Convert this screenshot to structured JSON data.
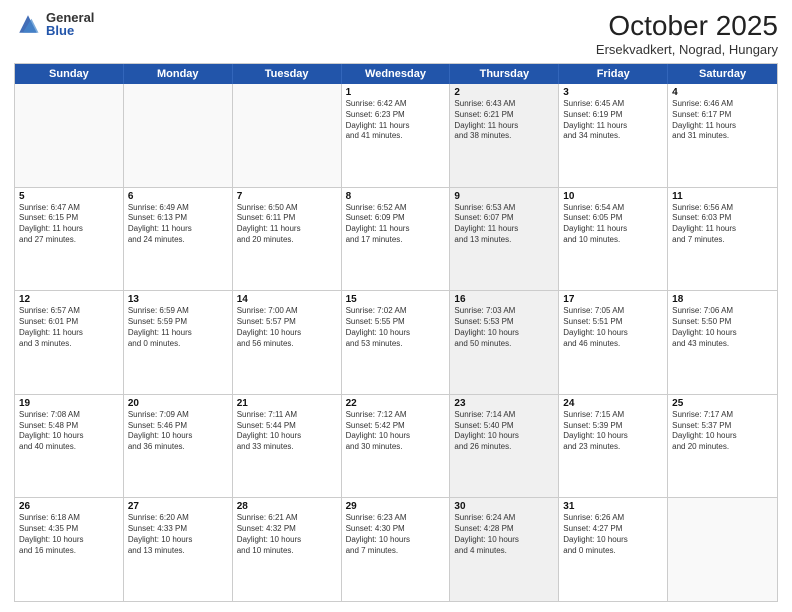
{
  "logo": {
    "general": "General",
    "blue": "Blue"
  },
  "title": {
    "month_year": "October 2025",
    "location": "Ersekvadkert, Nograd, Hungary"
  },
  "weekdays": [
    "Sunday",
    "Monday",
    "Tuesday",
    "Wednesday",
    "Thursday",
    "Friday",
    "Saturday"
  ],
  "rows": [
    [
      {
        "day": "",
        "info": "",
        "shaded": false,
        "empty": true
      },
      {
        "day": "",
        "info": "",
        "shaded": false,
        "empty": true
      },
      {
        "day": "",
        "info": "",
        "shaded": false,
        "empty": true
      },
      {
        "day": "1",
        "info": "Sunrise: 6:42 AM\nSunset: 6:23 PM\nDaylight: 11 hours\nand 41 minutes.",
        "shaded": false,
        "empty": false
      },
      {
        "day": "2",
        "info": "Sunrise: 6:43 AM\nSunset: 6:21 PM\nDaylight: 11 hours\nand 38 minutes.",
        "shaded": true,
        "empty": false
      },
      {
        "day": "3",
        "info": "Sunrise: 6:45 AM\nSunset: 6:19 PM\nDaylight: 11 hours\nand 34 minutes.",
        "shaded": false,
        "empty": false
      },
      {
        "day": "4",
        "info": "Sunrise: 6:46 AM\nSunset: 6:17 PM\nDaylight: 11 hours\nand 31 minutes.",
        "shaded": false,
        "empty": false
      }
    ],
    [
      {
        "day": "5",
        "info": "Sunrise: 6:47 AM\nSunset: 6:15 PM\nDaylight: 11 hours\nand 27 minutes.",
        "shaded": false,
        "empty": false
      },
      {
        "day": "6",
        "info": "Sunrise: 6:49 AM\nSunset: 6:13 PM\nDaylight: 11 hours\nand 24 minutes.",
        "shaded": false,
        "empty": false
      },
      {
        "day": "7",
        "info": "Sunrise: 6:50 AM\nSunset: 6:11 PM\nDaylight: 11 hours\nand 20 minutes.",
        "shaded": false,
        "empty": false
      },
      {
        "day": "8",
        "info": "Sunrise: 6:52 AM\nSunset: 6:09 PM\nDaylight: 11 hours\nand 17 minutes.",
        "shaded": false,
        "empty": false
      },
      {
        "day": "9",
        "info": "Sunrise: 6:53 AM\nSunset: 6:07 PM\nDaylight: 11 hours\nand 13 minutes.",
        "shaded": true,
        "empty": false
      },
      {
        "day": "10",
        "info": "Sunrise: 6:54 AM\nSunset: 6:05 PM\nDaylight: 11 hours\nand 10 minutes.",
        "shaded": false,
        "empty": false
      },
      {
        "day": "11",
        "info": "Sunrise: 6:56 AM\nSunset: 6:03 PM\nDaylight: 11 hours\nand 7 minutes.",
        "shaded": false,
        "empty": false
      }
    ],
    [
      {
        "day": "12",
        "info": "Sunrise: 6:57 AM\nSunset: 6:01 PM\nDaylight: 11 hours\nand 3 minutes.",
        "shaded": false,
        "empty": false
      },
      {
        "day": "13",
        "info": "Sunrise: 6:59 AM\nSunset: 5:59 PM\nDaylight: 11 hours\nand 0 minutes.",
        "shaded": false,
        "empty": false
      },
      {
        "day": "14",
        "info": "Sunrise: 7:00 AM\nSunset: 5:57 PM\nDaylight: 10 hours\nand 56 minutes.",
        "shaded": false,
        "empty": false
      },
      {
        "day": "15",
        "info": "Sunrise: 7:02 AM\nSunset: 5:55 PM\nDaylight: 10 hours\nand 53 minutes.",
        "shaded": false,
        "empty": false
      },
      {
        "day": "16",
        "info": "Sunrise: 7:03 AM\nSunset: 5:53 PM\nDaylight: 10 hours\nand 50 minutes.",
        "shaded": true,
        "empty": false
      },
      {
        "day": "17",
        "info": "Sunrise: 7:05 AM\nSunset: 5:51 PM\nDaylight: 10 hours\nand 46 minutes.",
        "shaded": false,
        "empty": false
      },
      {
        "day": "18",
        "info": "Sunrise: 7:06 AM\nSunset: 5:50 PM\nDaylight: 10 hours\nand 43 minutes.",
        "shaded": false,
        "empty": false
      }
    ],
    [
      {
        "day": "19",
        "info": "Sunrise: 7:08 AM\nSunset: 5:48 PM\nDaylight: 10 hours\nand 40 minutes.",
        "shaded": false,
        "empty": false
      },
      {
        "day": "20",
        "info": "Sunrise: 7:09 AM\nSunset: 5:46 PM\nDaylight: 10 hours\nand 36 minutes.",
        "shaded": false,
        "empty": false
      },
      {
        "day": "21",
        "info": "Sunrise: 7:11 AM\nSunset: 5:44 PM\nDaylight: 10 hours\nand 33 minutes.",
        "shaded": false,
        "empty": false
      },
      {
        "day": "22",
        "info": "Sunrise: 7:12 AM\nSunset: 5:42 PM\nDaylight: 10 hours\nand 30 minutes.",
        "shaded": false,
        "empty": false
      },
      {
        "day": "23",
        "info": "Sunrise: 7:14 AM\nSunset: 5:40 PM\nDaylight: 10 hours\nand 26 minutes.",
        "shaded": true,
        "empty": false
      },
      {
        "day": "24",
        "info": "Sunrise: 7:15 AM\nSunset: 5:39 PM\nDaylight: 10 hours\nand 23 minutes.",
        "shaded": false,
        "empty": false
      },
      {
        "day": "25",
        "info": "Sunrise: 7:17 AM\nSunset: 5:37 PM\nDaylight: 10 hours\nand 20 minutes.",
        "shaded": false,
        "empty": false
      }
    ],
    [
      {
        "day": "26",
        "info": "Sunrise: 6:18 AM\nSunset: 4:35 PM\nDaylight: 10 hours\nand 16 minutes.",
        "shaded": false,
        "empty": false
      },
      {
        "day": "27",
        "info": "Sunrise: 6:20 AM\nSunset: 4:33 PM\nDaylight: 10 hours\nand 13 minutes.",
        "shaded": false,
        "empty": false
      },
      {
        "day": "28",
        "info": "Sunrise: 6:21 AM\nSunset: 4:32 PM\nDaylight: 10 hours\nand 10 minutes.",
        "shaded": false,
        "empty": false
      },
      {
        "day": "29",
        "info": "Sunrise: 6:23 AM\nSunset: 4:30 PM\nDaylight: 10 hours\nand 7 minutes.",
        "shaded": false,
        "empty": false
      },
      {
        "day": "30",
        "info": "Sunrise: 6:24 AM\nSunset: 4:28 PM\nDaylight: 10 hours\nand 4 minutes.",
        "shaded": true,
        "empty": false
      },
      {
        "day": "31",
        "info": "Sunrise: 6:26 AM\nSunset: 4:27 PM\nDaylight: 10 hours\nand 0 minutes.",
        "shaded": false,
        "empty": false
      },
      {
        "day": "",
        "info": "",
        "shaded": false,
        "empty": true
      }
    ]
  ]
}
